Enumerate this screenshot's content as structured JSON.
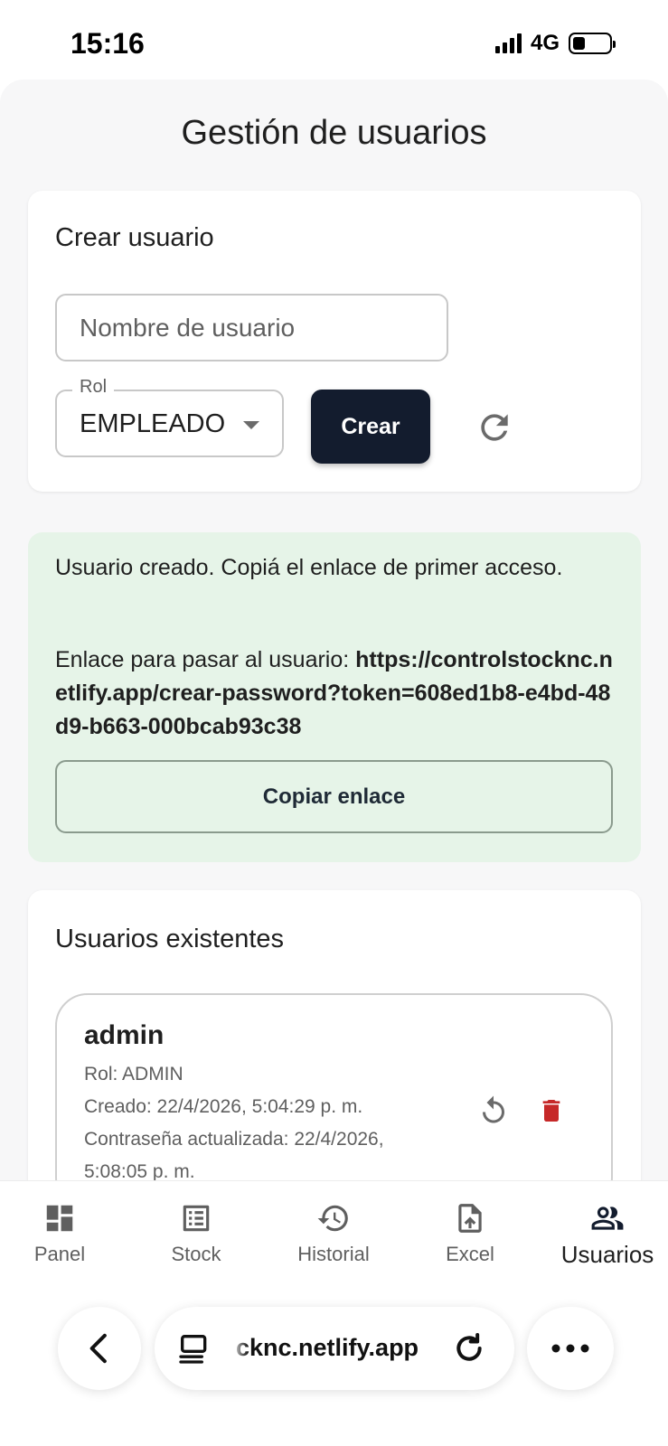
{
  "status_bar": {
    "time": "15:16",
    "network": "4G",
    "battery_level": 0.35
  },
  "page": {
    "title": "Gestión de usuarios"
  },
  "create_user": {
    "heading": "Crear usuario",
    "username_placeholder": "Nombre de usuario",
    "role_label": "Rol",
    "role_value": "EMPLEADO",
    "create_button": "Crear",
    "refresh_icon": "refresh-icon"
  },
  "success": {
    "message": "Usuario creado. Copiá el enlace de primer acceso.",
    "link_prefix": "Enlace para pasar al usuario: ",
    "link_url": "https://controlstocknc.netlify.app/crear-password?token=608ed1b8-e4bd-48d9-b663-000bcab93c38",
    "copy_button": "Copiar enlace",
    "background_color": "#e6f4e8"
  },
  "users": {
    "heading": "Usuarios existentes",
    "items": [
      {
        "name": "admin",
        "role": "Rol: ADMIN",
        "created": "Creado: 22/4/2026, 5:04:29 p. m.",
        "password_updated": "Contraseña actualizada: 22/4/2026, 5:08:05 p. m."
      }
    ],
    "delete_color": "#c62828"
  },
  "nav": {
    "items": [
      {
        "label": "Panel",
        "icon": "dashboard-icon"
      },
      {
        "label": "Stock",
        "icon": "list-icon"
      },
      {
        "label": "Historial",
        "icon": "history-icon"
      },
      {
        "label": "Excel",
        "icon": "file-upload-icon"
      },
      {
        "label": "Usuarios",
        "icon": "people-icon"
      }
    ],
    "active": "Usuarios"
  },
  "browser": {
    "url_display": "cknc.netlify.app"
  }
}
